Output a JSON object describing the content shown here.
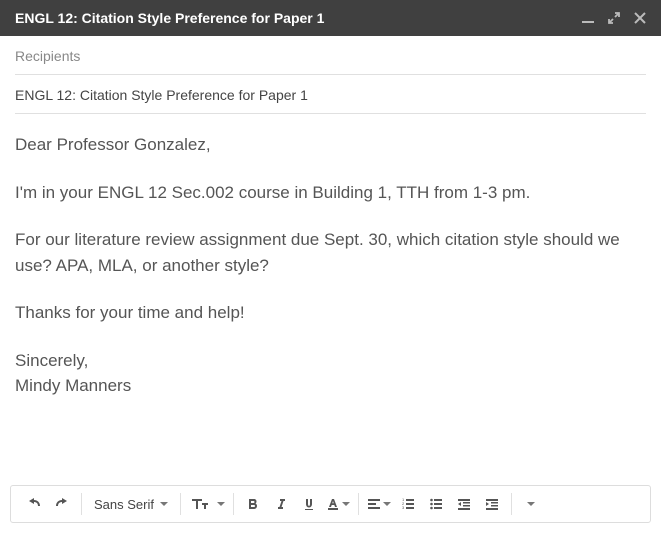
{
  "titlebar": {
    "title": "ENGL 12: Citation Style Preference for Paper 1"
  },
  "header": {
    "recipients_placeholder": "Recipients",
    "subject": "ENGL 12: Citation Style Preference for Paper 1"
  },
  "body": {
    "p1": "Dear Professor Gonzalez,",
    "p2": "I'm in your ENGL 12 Sec.002 course in Building 1, TTH from 1-3 pm.",
    "p3": "For our literature review assignment due Sept. 30, which citation style should we use? APA, MLA, or another style?",
    "p4": "Thanks for your time and help!",
    "p5": "Sincerely,",
    "p6": "Mindy Manners"
  },
  "toolbar": {
    "font_label": "Sans Serif"
  }
}
